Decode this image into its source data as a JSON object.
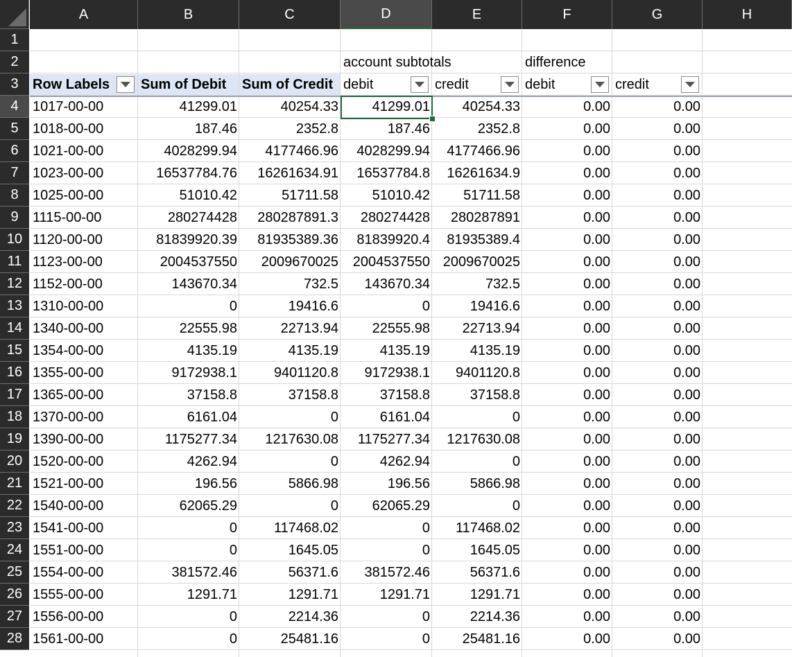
{
  "columns": [
    "A",
    "B",
    "C",
    "D",
    "E",
    "F",
    "G",
    "H"
  ],
  "selected_cell": "D4",
  "row2": {
    "d": "account subtotals",
    "f": "difference"
  },
  "row3": {
    "a": "Row Labels",
    "b": "Sum of Debit",
    "c": "Sum of Credit",
    "d": "debit",
    "e": "credit",
    "f": "debit",
    "g": "credit"
  },
  "rows": [
    {
      "n": "1",
      "a": "",
      "b": "",
      "c": "",
      "d": "",
      "e": "",
      "f": "",
      "g": ""
    },
    {
      "n": "2",
      "a": "",
      "b": "",
      "c": "",
      "d": "",
      "e": "",
      "f": "",
      "g": ""
    },
    {
      "n": "3",
      "a": "",
      "b": "",
      "c": "",
      "d": "",
      "e": "",
      "f": "",
      "g": ""
    },
    {
      "n": "4",
      "a": "1017-00-00",
      "b": "41299.01",
      "c": "40254.33",
      "d": "41299.01",
      "e": "40254.33",
      "f": "0.00",
      "g": "0.00"
    },
    {
      "n": "5",
      "a": "1018-00-00",
      "b": "187.46",
      "c": "2352.8",
      "d": "187.46",
      "e": "2352.8",
      "f": "0.00",
      "g": "0.00"
    },
    {
      "n": "6",
      "a": "1021-00-00",
      "b": "4028299.94",
      "c": "4177466.96",
      "d": "4028299.94",
      "e": "4177466.96",
      "f": "0.00",
      "g": "0.00"
    },
    {
      "n": "7",
      "a": "1023-00-00",
      "b": "16537784.76",
      "c": "16261634.91",
      "d": "16537784.8",
      "e": "16261634.9",
      "f": "0.00",
      "g": "0.00"
    },
    {
      "n": "8",
      "a": "1025-00-00",
      "b": "51010.42",
      "c": "51711.58",
      "d": "51010.42",
      "e": "51711.58",
      "f": "0.00",
      "g": "0.00"
    },
    {
      "n": "9",
      "a": "1115-00-00",
      "b": "280274428",
      "c": "280287891.3",
      "d": "280274428",
      "e": "280287891",
      "f": "0.00",
      "g": "0.00"
    },
    {
      "n": "10",
      "a": "1120-00-00",
      "b": "81839920.39",
      "c": "81935389.36",
      "d": "81839920.4",
      "e": "81935389.4",
      "f": "0.00",
      "g": "0.00"
    },
    {
      "n": "11",
      "a": "1123-00-00",
      "b": "2004537550",
      "c": "2009670025",
      "d": "2004537550",
      "e": "2009670025",
      "f": "0.00",
      "g": "0.00"
    },
    {
      "n": "12",
      "a": "1152-00-00",
      "b": "143670.34",
      "c": "732.5",
      "d": "143670.34",
      "e": "732.5",
      "f": "0.00",
      "g": "0.00"
    },
    {
      "n": "13",
      "a": "1310-00-00",
      "b": "0",
      "c": "19416.6",
      "d": "0",
      "e": "19416.6",
      "f": "0.00",
      "g": "0.00"
    },
    {
      "n": "14",
      "a": "1340-00-00",
      "b": "22555.98",
      "c": "22713.94",
      "d": "22555.98",
      "e": "22713.94",
      "f": "0.00",
      "g": "0.00"
    },
    {
      "n": "15",
      "a": "1354-00-00",
      "b": "4135.19",
      "c": "4135.19",
      "d": "4135.19",
      "e": "4135.19",
      "f": "0.00",
      "g": "0.00"
    },
    {
      "n": "16",
      "a": "1355-00-00",
      "b": "9172938.1",
      "c": "9401120.8",
      "d": "9172938.1",
      "e": "9401120.8",
      "f": "0.00",
      "g": "0.00"
    },
    {
      "n": "17",
      "a": "1365-00-00",
      "b": "37158.8",
      "c": "37158.8",
      "d": "37158.8",
      "e": "37158.8",
      "f": "0.00",
      "g": "0.00"
    },
    {
      "n": "18",
      "a": "1370-00-00",
      "b": "6161.04",
      "c": "0",
      "d": "6161.04",
      "e": "0",
      "f": "0.00",
      "g": "0.00"
    },
    {
      "n": "19",
      "a": "1390-00-00",
      "b": "1175277.34",
      "c": "1217630.08",
      "d": "1175277.34",
      "e": "1217630.08",
      "f": "0.00",
      "g": "0.00"
    },
    {
      "n": "20",
      "a": "1520-00-00",
      "b": "4262.94",
      "c": "0",
      "d": "4262.94",
      "e": "0",
      "f": "0.00",
      "g": "0.00"
    },
    {
      "n": "21",
      "a": "1521-00-00",
      "b": "196.56",
      "c": "5866.98",
      "d": "196.56",
      "e": "5866.98",
      "f": "0.00",
      "g": "0.00"
    },
    {
      "n": "22",
      "a": "1540-00-00",
      "b": "62065.29",
      "c": "0",
      "d": "62065.29",
      "e": "0",
      "f": "0.00",
      "g": "0.00"
    },
    {
      "n": "23",
      "a": "1541-00-00",
      "b": "0",
      "c": "117468.02",
      "d": "0",
      "e": "117468.02",
      "f": "0.00",
      "g": "0.00"
    },
    {
      "n": "24",
      "a": "1551-00-00",
      "b": "0",
      "c": "1645.05",
      "d": "0",
      "e": "1645.05",
      "f": "0.00",
      "g": "0.00"
    },
    {
      "n": "25",
      "a": "1554-00-00",
      "b": "381572.46",
      "c": "56371.6",
      "d": "381572.46",
      "e": "56371.6",
      "f": "0.00",
      "g": "0.00"
    },
    {
      "n": "26",
      "a": "1555-00-00",
      "b": "1291.71",
      "c": "1291.71",
      "d": "1291.71",
      "e": "1291.71",
      "f": "0.00",
      "g": "0.00"
    },
    {
      "n": "27",
      "a": "1556-00-00",
      "b": "0",
      "c": "2214.36",
      "d": "0",
      "e": "2214.36",
      "f": "0.00",
      "g": "0.00"
    },
    {
      "n": "28",
      "a": "1561-00-00",
      "b": "0",
      "c": "25481.16",
      "d": "0",
      "e": "25481.16",
      "f": "0.00",
      "g": "0.00"
    }
  ],
  "colors": {
    "header_bg": "#2b2b2b",
    "header_text": "#ffffff",
    "pivot_header_bg": "#dde6f4",
    "selection": "#1e6b3a",
    "gridline": "#d8d8d8"
  }
}
